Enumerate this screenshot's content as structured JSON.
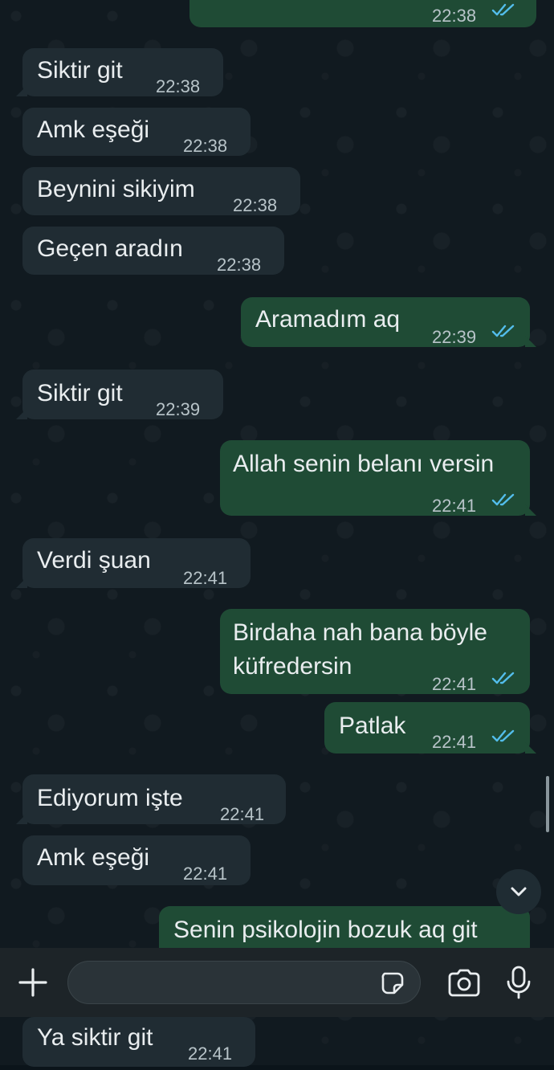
{
  "colors": {
    "incoming_bubble": "#202c33",
    "outgoing_bubble": "#1f4b35",
    "read_ticks": "#53bdeb",
    "timestamp": "#b8c4c9"
  },
  "messages": [
    {
      "direction": "outgoing",
      "text": "",
      "time": "22:38",
      "read": true
    },
    {
      "direction": "incoming",
      "text": "Siktir git",
      "time": "22:38"
    },
    {
      "direction": "incoming",
      "text": "Amk eşeği",
      "time": "22:38"
    },
    {
      "direction": "incoming",
      "text": "Beynini sikiyim",
      "time": "22:38"
    },
    {
      "direction": "incoming",
      "text": "Geçen aradın",
      "time": "22:38"
    },
    {
      "direction": "outgoing",
      "text": "Aramadım aq",
      "time": "22:39",
      "read": true
    },
    {
      "direction": "incoming",
      "text": "Siktir git",
      "time": "22:39"
    },
    {
      "direction": "outgoing",
      "text": "Allah senin belanı versin",
      "time": "22:41",
      "read": true
    },
    {
      "direction": "incoming",
      "text": "Verdi şuan",
      "time": "22:41"
    },
    {
      "direction": "outgoing",
      "text_line1": "Birdaha nah bana böyle",
      "text_line2": "küfredersin",
      "time": "22:41",
      "read": true
    },
    {
      "direction": "outgoing",
      "text": "Patlak",
      "time": "22:41",
      "read": true
    },
    {
      "direction": "incoming",
      "text": "Ediyorum işte",
      "time": "22:41"
    },
    {
      "direction": "incoming",
      "text": "Amk eşeği",
      "time": "22:41"
    },
    {
      "direction": "outgoing",
      "text": "Senin psikolojin bozuk aq git",
      "time": ""
    },
    {
      "direction": "incoming",
      "text": "Ya siktir git",
      "time": "22:41"
    }
  ],
  "composer": {
    "attach_icon": "plus-icon",
    "sticker_icon": "sticker-icon",
    "camera_icon": "camera-icon",
    "mic_icon": "microphone-icon",
    "input_value": ""
  },
  "scroll_button_icon": "chevron-down-icon"
}
